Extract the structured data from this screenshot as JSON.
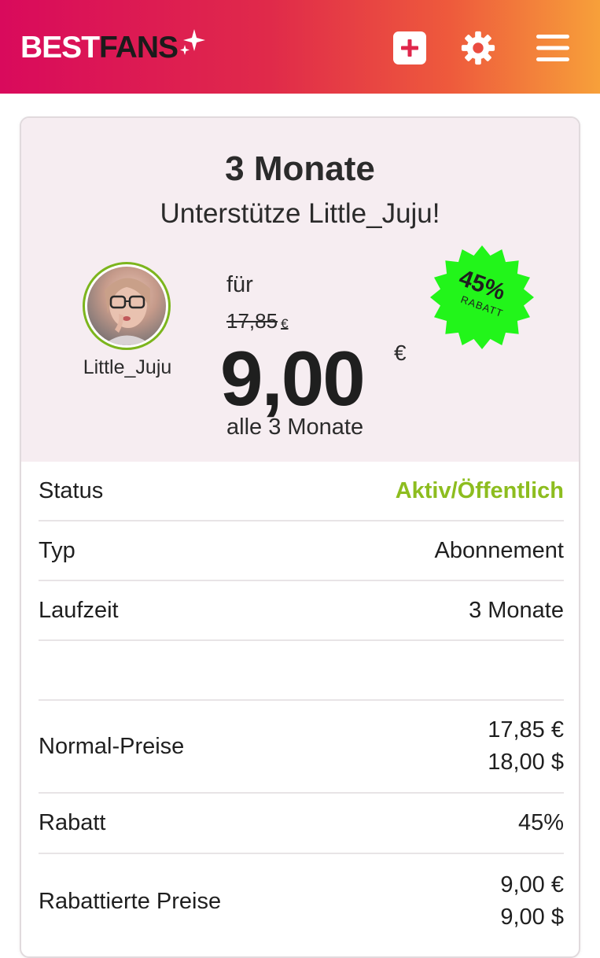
{
  "header": {
    "logo_best": "BEST",
    "logo_fans": "FANS",
    "icons": [
      "add-icon",
      "settings-icon",
      "menu-icon"
    ],
    "gradient": [
      "#d90a5c",
      "#f7a03a"
    ]
  },
  "offer": {
    "title": "3 Monate",
    "subtitle": "Unterstütze Little_Juju!",
    "creator_name": "Little_Juju",
    "for_label": "für",
    "old_price": "17,85",
    "old_currency": "€",
    "price": "9,00",
    "currency": "€",
    "period": "alle 3 Monate",
    "badge": {
      "percent": "45%",
      "label": "RABATT",
      "color": "#22f51a"
    }
  },
  "details": {
    "status_label": "Status",
    "status_value": "Aktiv/Öffentlich",
    "status_color": "#8dbd1f",
    "type_label": "Typ",
    "type_value": "Abonnement",
    "duration_label": "Laufzeit",
    "duration_value": "3 Monate",
    "normal_label": "Normal-Preise",
    "normal_eur": "17,85 €",
    "normal_usd": "18,00 $",
    "discount_label": "Rabatt",
    "discount_value": "45%",
    "discounted_label": "Rabattierte Preise",
    "discounted_eur": "9,00 €",
    "discounted_usd": "9,00 $"
  }
}
